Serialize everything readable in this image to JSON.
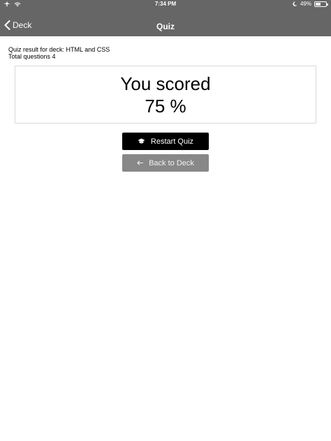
{
  "status_bar": {
    "time": "7:34 PM",
    "battery": "49%",
    "battery_level": 0.49
  },
  "nav": {
    "back_label": "Deck",
    "title": "Quiz"
  },
  "quiz": {
    "result_text": "Quiz result for deck: HTML and CSS",
    "total_text": "Total questions 4"
  },
  "score": {
    "line1": "You scored",
    "line2": "75 %"
  },
  "buttons": {
    "restart_label": "Restart Quiz",
    "back_label": "Back to Deck"
  },
  "colors": {
    "header_bg": "#666666",
    "restart_bg": "#000000",
    "back_bg": "#888888"
  }
}
